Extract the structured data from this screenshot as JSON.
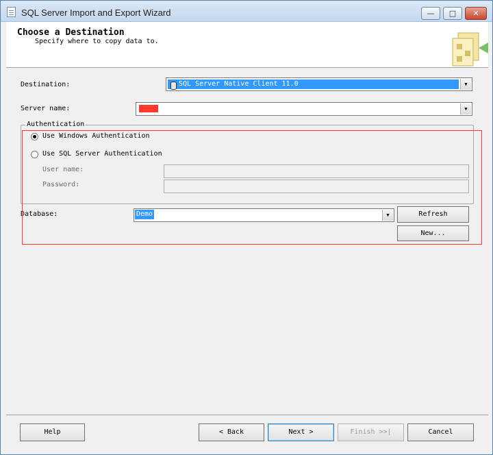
{
  "window": {
    "title": "SQL Server Import and Export Wizard"
  },
  "header": {
    "title": "Choose a Destination",
    "subtitle": "Specify where to copy data to."
  },
  "form": {
    "destination_label": "Destination:",
    "destination_value": "SQL Server Native Client 11.0",
    "server_name_label": "Server name:",
    "server_name_value": ".",
    "authentication": {
      "group_label": "Authentication",
      "windows_auth_label": "Use Windows Authentication",
      "sql_auth_label": "Use SQL Server Authentication",
      "selected": "windows",
      "username_label": "User name:",
      "password_label": "Password:"
    },
    "database_label": "Database:",
    "database_value": "Demo",
    "refresh_label": "Refresh",
    "new_label": "New..."
  },
  "footer": {
    "help_label": "Help",
    "back_label": "< Back",
    "next_label": "Next >",
    "finish_label": "Finish >>|",
    "cancel_label": "Cancel"
  },
  "colors": {
    "selection": "#3399ff",
    "highlight_box": "#ff3333",
    "server_redaction": "#ff3b30"
  }
}
